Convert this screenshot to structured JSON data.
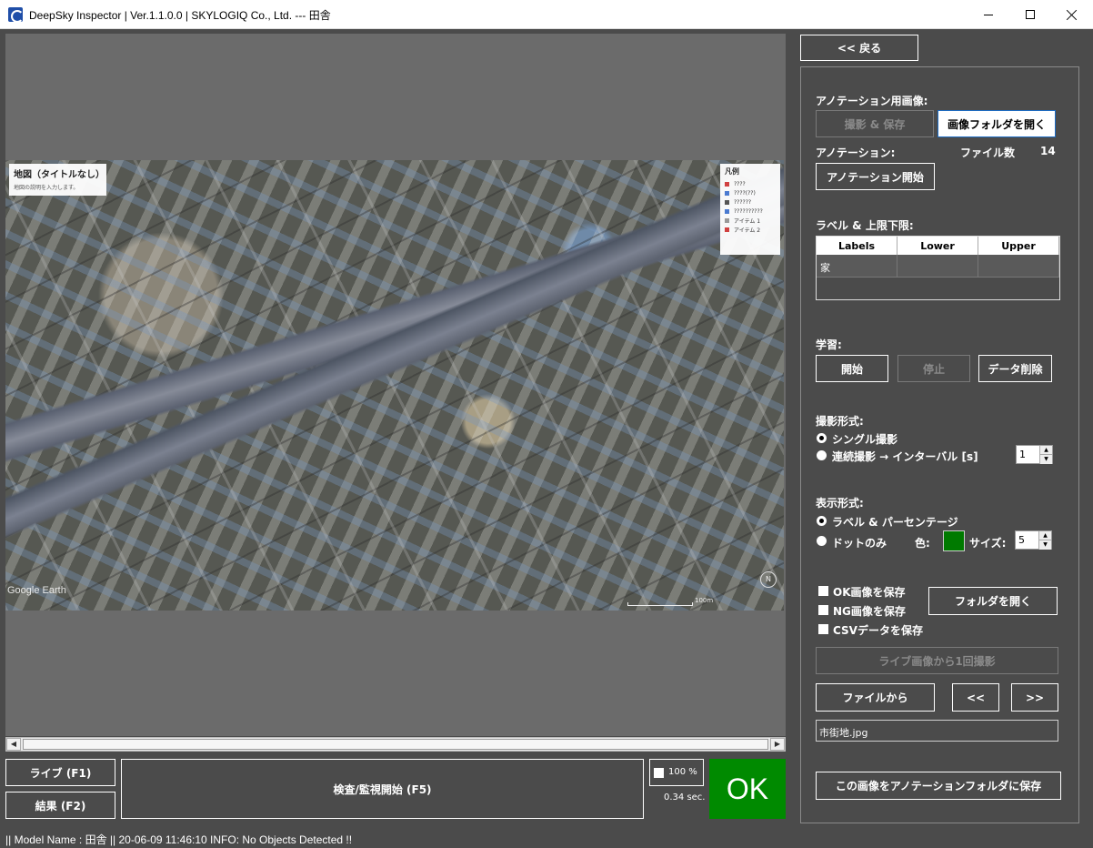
{
  "window": {
    "title": "DeepSky Inspector | Ver.1.1.0.0 | SKYLOGIQ Co., Ltd. --- 田舎"
  },
  "map": {
    "title": "地図（タイトルなし）",
    "description": "地図の説明を入力します。",
    "legend_title": "凡例",
    "legend_items": [
      {
        "label": "????",
        "color": "#d04040"
      },
      {
        "label": "????(??)",
        "color": "#4a7ad0"
      },
      {
        "label": "??????",
        "color": "#555555"
      },
      {
        "label": "??????????",
        "color": "#4a7ad0"
      },
      {
        "label": "アイテム 1",
        "color": "#999999"
      },
      {
        "label": "アイテム 2",
        "color": "#d04040"
      }
    ],
    "watermark": "Google Earth",
    "scale": "100m",
    "compass": "N"
  },
  "bottom": {
    "live_button": "ライブ (F1)",
    "result_button": "結果 (F2)",
    "start_button": "検査/監視開始 (F5)",
    "zoom_value": "100 %",
    "timing": "0.34 sec.",
    "result": "OK",
    "result_color": "#008a00"
  },
  "status": {
    "text": "|| Model Name : 田舎 ||    20-06-09 11:46:10   INFO:   No Objects Detected !!"
  },
  "panel": {
    "back_button": "<< 戻る",
    "annotation_images_label": "アノテーション用画像:",
    "capture_save_button": "撮影 & 保存",
    "open_image_folder_button": "画像フォルダを開く",
    "annotation_label": "アノテーション:",
    "file_count_label": "ファイル数",
    "file_count_value": "14",
    "start_annotation_button": "アノテーション開始",
    "labels_limits_label": "ラベル & 上限下限:",
    "table_headers": [
      "Labels",
      "Lower",
      "Upper"
    ],
    "table_rows": [
      [
        "家",
        "",
        ""
      ]
    ],
    "learning_label": "学習:",
    "learn_start_button": "開始",
    "learn_stop_button": "停止",
    "delete_data_button": "データ削除",
    "capture_mode_label": "撮影形式:",
    "single_shot": "シングル撮影",
    "continuous_shot": "連続撮影 → インターバル [s]",
    "interval_value": "1",
    "display_mode_label": "表示形式:",
    "label_percentage": "ラベル & パーセンテージ",
    "dot_only": "ドットのみ",
    "color_label": "色:",
    "dot_color": "#007a00",
    "size_label": "サイズ:",
    "size_value": "5",
    "save_ok": "OK画像を保存",
    "save_ng": "NG画像を保存",
    "save_csv": "CSVデータを保存",
    "open_folder_button": "フォルダを開く",
    "capture_once_button": "ライブ画像から1回撮影",
    "from_file_button": "ファイルから",
    "prev_button": "<<",
    "next_button": ">>",
    "file_name": "市街地.jpg",
    "save_to_annotation_button": "この画像をアノテーションフォルダに保存"
  }
}
